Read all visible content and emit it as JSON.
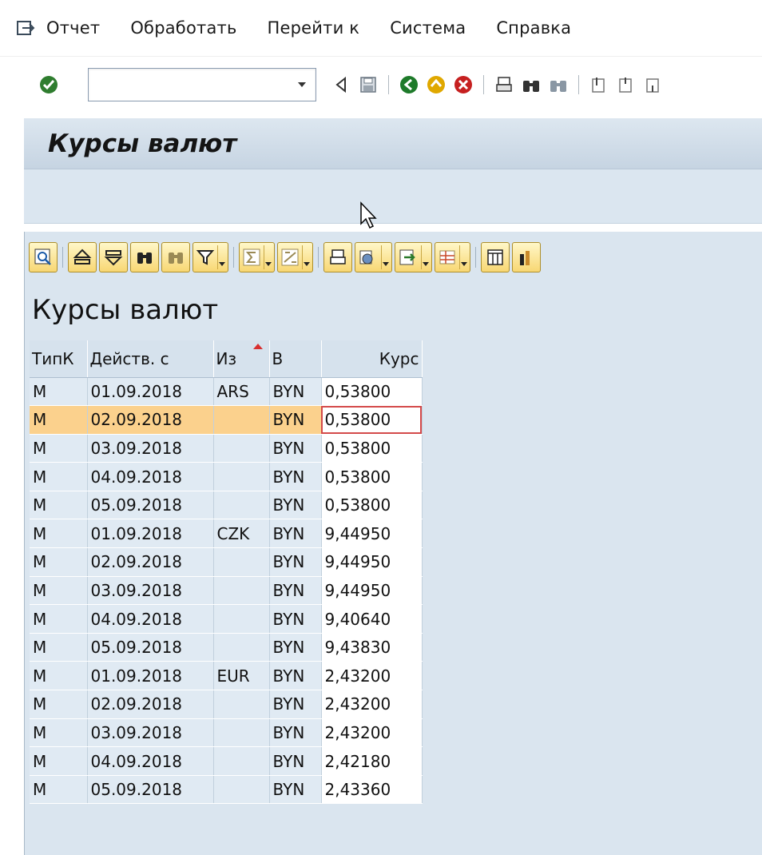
{
  "menubar": {
    "items": [
      {
        "label": "Отчет"
      },
      {
        "label": "Обработать"
      },
      {
        "label": "Перейти к"
      },
      {
        "label": "Система"
      },
      {
        "label": "Справка"
      }
    ]
  },
  "toolbar": {
    "command_value": ""
  },
  "title": "Курсы валют",
  "alv": {
    "title": "Курсы валют"
  },
  "table": {
    "headers": [
      "ТипК",
      "Действ. с",
      "Из",
      "В",
      "Курс"
    ],
    "rows": [
      {
        "tip": "M",
        "date": "01.09.2018",
        "iz": "ARS",
        "v": "BYN",
        "kurs": "0,53800"
      },
      {
        "tip": "M",
        "date": "02.09.2018",
        "iz": "",
        "v": "BYN",
        "kurs": "0,53800"
      },
      {
        "tip": "M",
        "date": "03.09.2018",
        "iz": "",
        "v": "BYN",
        "kurs": "0,53800"
      },
      {
        "tip": "M",
        "date": "04.09.2018",
        "iz": "",
        "v": "BYN",
        "kurs": "0,53800"
      },
      {
        "tip": "M",
        "date": "05.09.2018",
        "iz": "",
        "v": "BYN",
        "kurs": "0,53800"
      },
      {
        "tip": "M",
        "date": "01.09.2018",
        "iz": "CZK",
        "v": "BYN",
        "kurs": "9,44950"
      },
      {
        "tip": "M",
        "date": "02.09.2018",
        "iz": "",
        "v": "BYN",
        "kurs": "9,44950"
      },
      {
        "tip": "M",
        "date": "03.09.2018",
        "iz": "",
        "v": "BYN",
        "kurs": "9,44950"
      },
      {
        "tip": "M",
        "date": "04.09.2018",
        "iz": "",
        "v": "BYN",
        "kurs": "9,40640"
      },
      {
        "tip": "M",
        "date": "05.09.2018",
        "iz": "",
        "v": "BYN",
        "kurs": "9,43830"
      },
      {
        "tip": "M",
        "date": "01.09.2018",
        "iz": "EUR",
        "v": "BYN",
        "kurs": "2,43200"
      },
      {
        "tip": "M",
        "date": "02.09.2018",
        "iz": "",
        "v": "BYN",
        "kurs": "2,43200"
      },
      {
        "tip": "M",
        "date": "03.09.2018",
        "iz": "",
        "v": "BYN",
        "kurs": "2,43200"
      },
      {
        "tip": "M",
        "date": "04.09.2018",
        "iz": "",
        "v": "BYN",
        "kurs": "2,42180"
      },
      {
        "tip": "M",
        "date": "05.09.2018",
        "iz": "",
        "v": "BYN",
        "kurs": "2,43360"
      }
    ]
  }
}
